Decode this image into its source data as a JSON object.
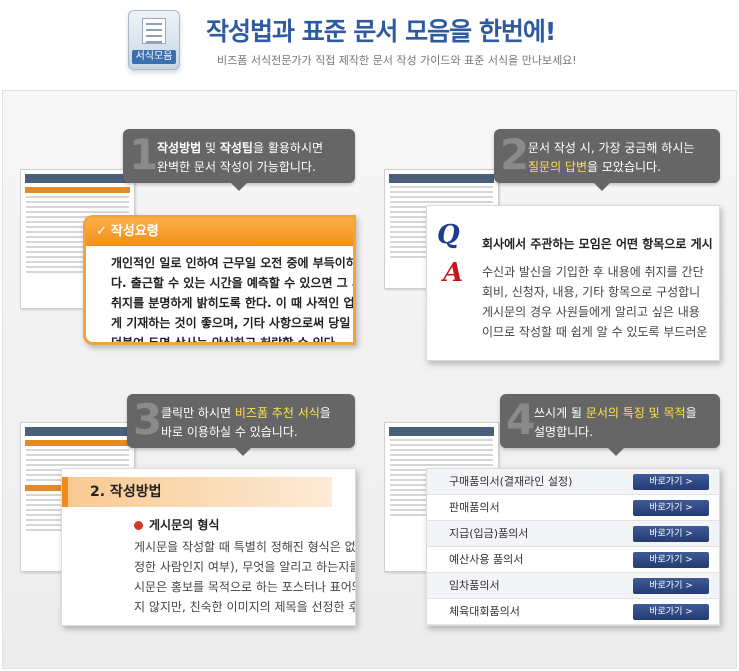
{
  "header": {
    "icon_label": "서식모음",
    "title": "작성법과 표준 문서 모음을 한번에!",
    "subtitle": "비즈폼 서식전문가가 직접 제작한 문서 작성 가이드와 표준 서식을 만나보세요!"
  },
  "sections": [
    {
      "number": "1",
      "bubble": {
        "part1": "작성방법",
        "part2": " 및 ",
        "part3": "작성팁",
        "part4": "을 활용하시면",
        "line2": "완벽한 문서 작성이 가능합니다."
      },
      "card_title": "작성요령",
      "lines": [
        "개인적인 일로 인하여 근무일 오전 중에 부득이하",
        "다. 출근할 수 있는 시간을 예측할 수 있으면 그 시",
        "취지를 분명하게 밝히도록 한다. 이 때 사적인 업",
        "게 기재하는 것이 좋으며, 기타 사항으로써 당일",
        "덧붙여 두면 상사는 안심하고 허락할 수 있다."
      ]
    },
    {
      "number": "2",
      "bubble": {
        "line1": "문서 작성 시, 가장 궁금해 하시는",
        "hl": "질문의 답변",
        "line2_rest": "을 모았습니다."
      },
      "q_letter": "Q",
      "a_letter": "A",
      "question": "회사에서 주관하는 모임은 어떤 항목으로 게시",
      "answer_lines": [
        "수신과 발신을 기입한 후 내용에 취지를 간단",
        "회비, 신청자, 내용, 기타 항목으로 구성합니",
        "게시문의 경우 사원들에게 알리고 싶은 내용",
        "이므로 작성할 때 쉽게 알 수 있도록 부드러운"
      ]
    },
    {
      "number": "3",
      "bubble": {
        "part1": "클릭만 하시면 ",
        "hl": "비즈폼 추천 서식",
        "part2": "을",
        "line2": "바로 이용하실 수 있습니다."
      },
      "section_title": "2.  작성방법",
      "sub_title": "게시문의 형식",
      "lines": [
        "게시문을 작성할 때 특별히 정해진 형식은 없지만",
        "정한 사람인지 여부), 무엇을 알리고 하는지를",
        "시문은 홍보를 목적으로 하는 포스터나 표어와는",
        "지 않지만, 친숙한 이미지의 제목을 선정한 후에"
      ]
    },
    {
      "number": "4",
      "bubble": {
        "part1": "쓰시게 될 ",
        "hl": "문서의 특징 및 목적",
        "part2": "을",
        "line2": "설명합니다."
      },
      "items": [
        "구매품의서(결재라인 설정)",
        "판매품의서",
        "지급(입금)품의서",
        "예산사용 품의서",
        "임차품의서",
        "체육대회품의서"
      ],
      "button_label": "바로가기 >"
    }
  ]
}
